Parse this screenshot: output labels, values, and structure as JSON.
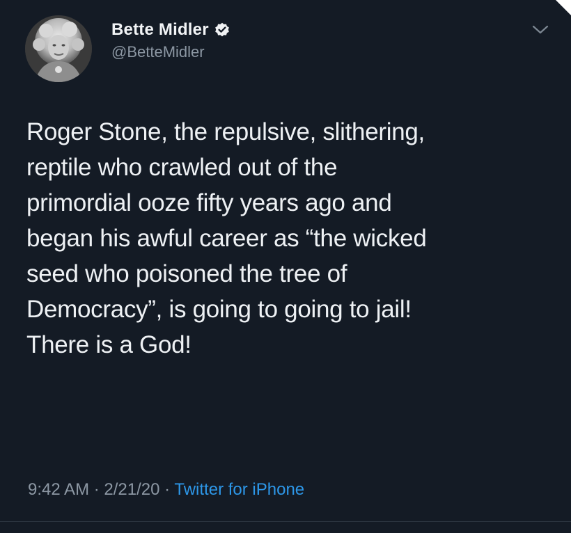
{
  "tweet": {
    "author": {
      "display_name": "Bette Midler",
      "handle": "@BetteMidler",
      "verified": true,
      "verified_icon": "verified-badge-icon",
      "avatar_icon": "profile-avatar"
    },
    "menu_icon": "chevron-down-icon",
    "text": "Roger Stone, the repulsive, slithering,\nreptile who crawled out of the\nprimordial ooze fifty years ago and\nbegan his awful career as “the wicked\nseed who poisoned the tree of\nDemocracy”, is going to going to jail!\nThere is a God!",
    "time": "9:42 AM",
    "separator": "·",
    "date": "2/21/20",
    "source": "Twitter for iPhone"
  },
  "colors": {
    "background": "#141b25",
    "primary_text": "#eef1f4",
    "secondary_text": "#8c97a3",
    "link": "#2d97e8"
  }
}
